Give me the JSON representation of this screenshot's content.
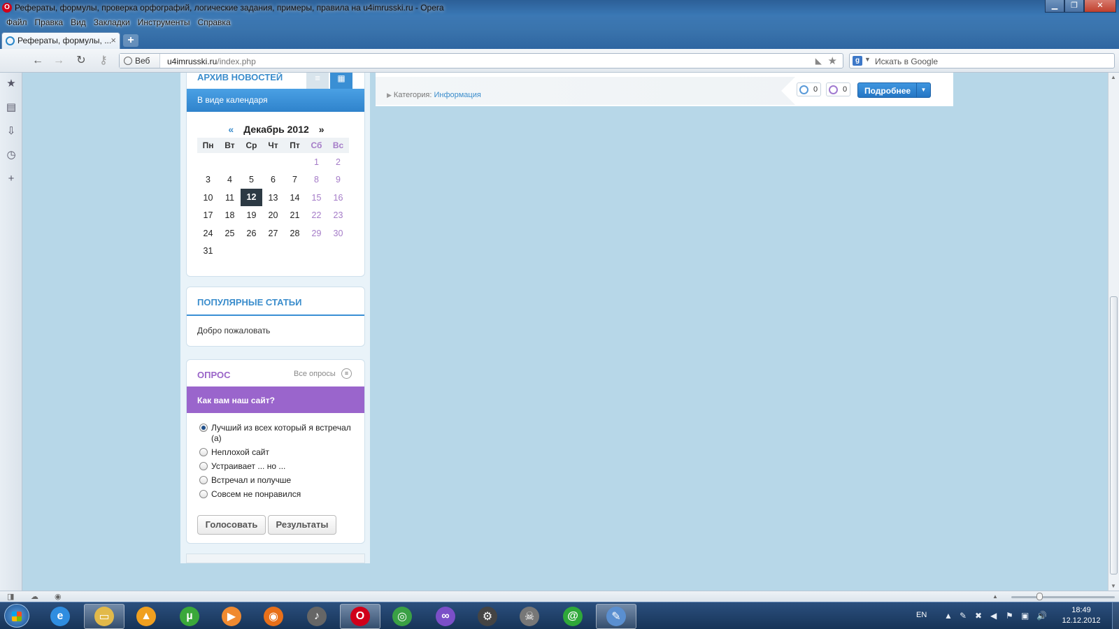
{
  "window": {
    "title": "Рефераты, формулы, проверка орфографий, логические задания, примеры, правила на u4imrusski.ru - Opera",
    "minimize": "▁",
    "restore": "❐",
    "close": "✕"
  },
  "menu": [
    "Файл",
    "Правка",
    "Вид",
    "Закладки",
    "Инструменты",
    "Справка"
  ],
  "tab": {
    "label": "Рефераты, формулы, ...",
    "close": "×",
    "new_tab": "+"
  },
  "nav": {
    "back": "←",
    "forward": "→",
    "reload": "↻",
    "key": "⚷",
    "web_label": "Веб",
    "url_host": "u4imrusski.ru",
    "url_path": "/index.php",
    "rss": "◣",
    "bookmark_star": "★",
    "search_engine": "g",
    "search_placeholder": "Искать в Google"
  },
  "sidepanel_icons": [
    "★",
    "▤",
    "⇩",
    "◷",
    "+"
  ],
  "archive": {
    "title": "АРХИВ НОВОСТЕЙ",
    "list_icon": "≡",
    "grid_icon": "▦",
    "mode": "В виде календаря",
    "prev": "«",
    "next": "»",
    "month": "Декабрь 2012",
    "weekdays": [
      "Пн",
      "Вт",
      "Ср",
      "Чт",
      "Пт",
      "Сб",
      "Вс"
    ],
    "weeks": [
      [
        "",
        "",
        "",
        "",
        "",
        "1",
        "2"
      ],
      [
        "3",
        "4",
        "5",
        "6",
        "7",
        "8",
        "9"
      ],
      [
        "10",
        "11",
        "12",
        "13",
        "14",
        "15",
        "16"
      ],
      [
        "17",
        "18",
        "19",
        "20",
        "21",
        "22",
        "23"
      ],
      [
        "24",
        "25",
        "26",
        "27",
        "28",
        "29",
        "30"
      ],
      [
        "31",
        "",
        "",
        "",
        "",
        "",
        ""
      ]
    ],
    "today": "12"
  },
  "popular": {
    "title": "ПОПУЛЯРНЫЕ СТАТЬИ",
    "item": "Добро пожаловать"
  },
  "poll": {
    "title": "ОПРОС",
    "all_polls": "Все опросы",
    "menu_icon": "≡",
    "question": "Как вам наш сайт?",
    "options": [
      "Лучший из всех который я встречал (а)",
      "Неплохой сайт",
      "Устраивает ... но ...",
      "Встречал и получше",
      "Совсем не понравился"
    ],
    "selected": 0,
    "vote": "Голосовать",
    "results": "Результаты"
  },
  "article": {
    "category_label": "Категория:",
    "category_link": "Информация",
    "comments_count": "0",
    "likes_count": "0",
    "more": "Подробнее",
    "more_dropdown": "▼"
  },
  "statusbar": {
    "panel_icon": "◨",
    "cloud_icon": "☁",
    "speed_icon": "◉",
    "up_icon": "▲"
  },
  "taskbar": {
    "apps": [
      {
        "name": "internet-explorer",
        "glyph": "e",
        "color": "#2f8de0"
      },
      {
        "name": "explorer",
        "glyph": "▭",
        "color": "#e2b94a"
      },
      {
        "name": "aimp",
        "glyph": "▲",
        "color": "#f0a020"
      },
      {
        "name": "utorrent",
        "glyph": "µ",
        "color": "#3aa83a"
      },
      {
        "name": "media-player",
        "glyph": "▶",
        "color": "#f08a30"
      },
      {
        "name": "firefox",
        "glyph": "◉",
        "color": "#e8701a"
      },
      {
        "name": "qip",
        "glyph": "♪",
        "color": "#666666"
      },
      {
        "name": "opera",
        "glyph": "O",
        "color": "#d0001a"
      },
      {
        "name": "chrome",
        "glyph": "◎",
        "color": "#3aa045"
      },
      {
        "name": "visual-studio",
        "glyph": "∞",
        "color": "#7b4fc8"
      },
      {
        "name": "settings",
        "glyph": "⚙",
        "color": "#444444"
      },
      {
        "name": "game",
        "glyph": "☠",
        "color": "#777777"
      },
      {
        "name": "mail-agent",
        "glyph": "@",
        "color": "#2fa83a"
      },
      {
        "name": "paint",
        "glyph": "✎",
        "color": "#5a8fd0"
      }
    ],
    "lang": "EN",
    "tray_icons": [
      "▲",
      "✎",
      "✖",
      "◀",
      "⚑",
      "▣",
      "🔊"
    ],
    "time": "18:49",
    "date": "12.12.2012"
  }
}
